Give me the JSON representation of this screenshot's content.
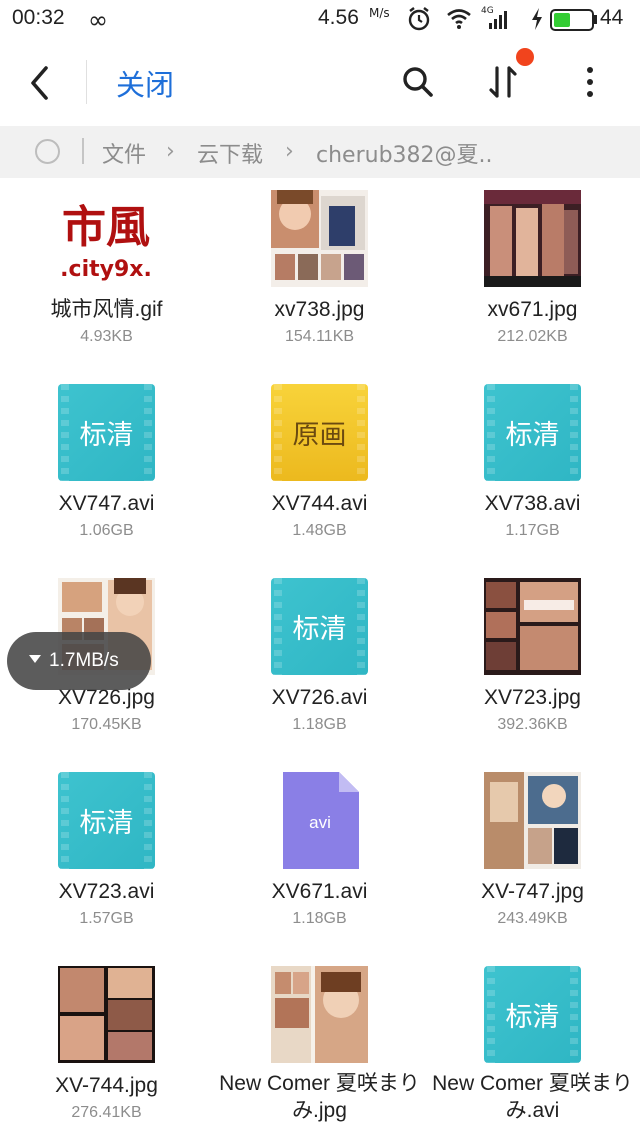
{
  "status_bar": {
    "time": "00:32",
    "infinity": "∞",
    "speed": "4.56",
    "speed_unit": "M/s",
    "network": "4G",
    "battery": 44,
    "battery_label": "44"
  },
  "header": {
    "close_label": "关闭"
  },
  "breadcrumb": {
    "items": [
      "文件",
      "云下载",
      "cherub382@夏.."
    ]
  },
  "download_speed": "1.7MB/s",
  "files": [
    {
      "name": "城市风情.gif",
      "size": "4.93KB",
      "thumb_type": "image"
    },
    {
      "name": "xv738.jpg",
      "size": "154.11KB",
      "thumb_type": "image"
    },
    {
      "name": "xv671.jpg",
      "size": "212.02KB",
      "thumb_type": "image"
    },
    {
      "name": "XV747.avi",
      "size": "1.06GB",
      "thumb_type": "video",
      "thumb_label": "标清"
    },
    {
      "name": "XV744.avi",
      "size": "1.48GB",
      "thumb_type": "video",
      "thumb_label": "原画"
    },
    {
      "name": "XV738.avi",
      "size": "1.17GB",
      "thumb_type": "video",
      "thumb_label": "标清"
    },
    {
      "name": "XV726.jpg",
      "size": "170.45KB",
      "thumb_type": "image"
    },
    {
      "name": "XV726.avi",
      "size": "1.18GB",
      "thumb_type": "video",
      "thumb_label": "标清"
    },
    {
      "name": "XV723.jpg",
      "size": "392.36KB",
      "thumb_type": "image"
    },
    {
      "name": "XV723.avi",
      "size": "1.57GB",
      "thumb_type": "video",
      "thumb_label": "标清"
    },
    {
      "name": "XV671.avi",
      "size": "1.18GB",
      "thumb_type": "file",
      "thumb_label": "avi"
    },
    {
      "name": "XV-747.jpg",
      "size": "243.49KB",
      "thumb_type": "image"
    },
    {
      "name": "XV-744.jpg",
      "size": "276.41KB",
      "thumb_type": "image"
    },
    {
      "name": "New Comer 夏咲まりみ.jpg",
      "size": "",
      "thumb_type": "image"
    },
    {
      "name": "New Comer 夏咲まりみ.avi",
      "size": "",
      "thumb_type": "video",
      "thumb_label": "标清"
    }
  ],
  "thumb_texts": {
    "city_logo_top": "市風",
    "city_logo_bottom": ".city9x."
  },
  "colors": {
    "accent": "#1e6fd9",
    "notification_dot": "#f1441d",
    "video_teal": "#34bcca",
    "video_gold": "#f2c52c",
    "file_purple": "#8a7fe6",
    "battery_green": "#33cc33"
  }
}
